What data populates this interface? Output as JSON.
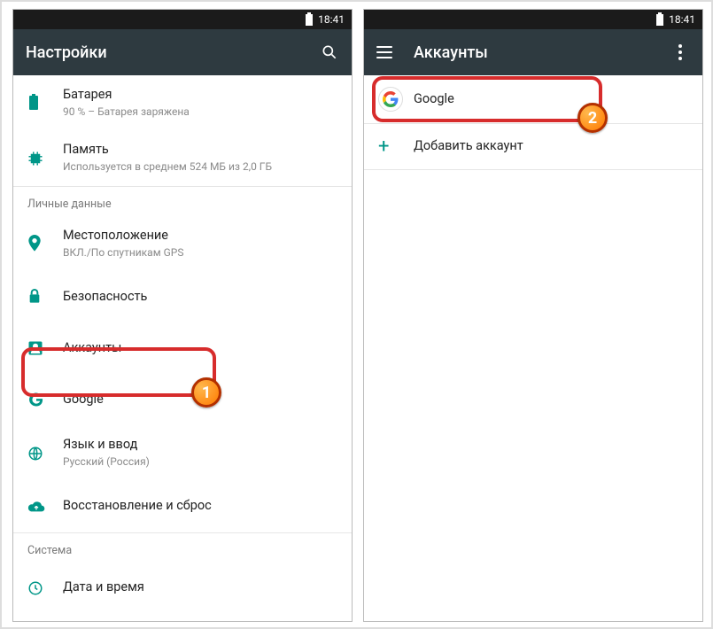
{
  "status": {
    "time": "18:41"
  },
  "left": {
    "appbar": {
      "title": "Настройки"
    },
    "rows": {
      "battery": {
        "title": "Батарея",
        "subtitle": "90 % – Батарея заряжена"
      },
      "memory": {
        "title": "Память",
        "subtitle": "Используется в среднем 524 МБ из 2,0 ГБ"
      },
      "location": {
        "title": "Местоположение",
        "subtitle": "ВКЛ./По спутникам GPS"
      },
      "security": {
        "title": "Безопасность"
      },
      "accounts": {
        "title": "Аккаунты"
      },
      "google": {
        "title": "Google"
      },
      "language": {
        "title": "Язык и ввод",
        "subtitle": "Русский (Россия)"
      },
      "backup": {
        "title": "Восстановление и сброс"
      },
      "datetime": {
        "title": "Дата и время"
      }
    },
    "sections": {
      "personal": "Личные данные",
      "system": "Система"
    }
  },
  "right": {
    "appbar": {
      "title": "Аккаунты"
    },
    "rows": {
      "google": {
        "title": "Google"
      },
      "add": {
        "title": "Добавить аккаунт"
      }
    }
  },
  "badges": {
    "step1": "1",
    "step2": "2"
  }
}
